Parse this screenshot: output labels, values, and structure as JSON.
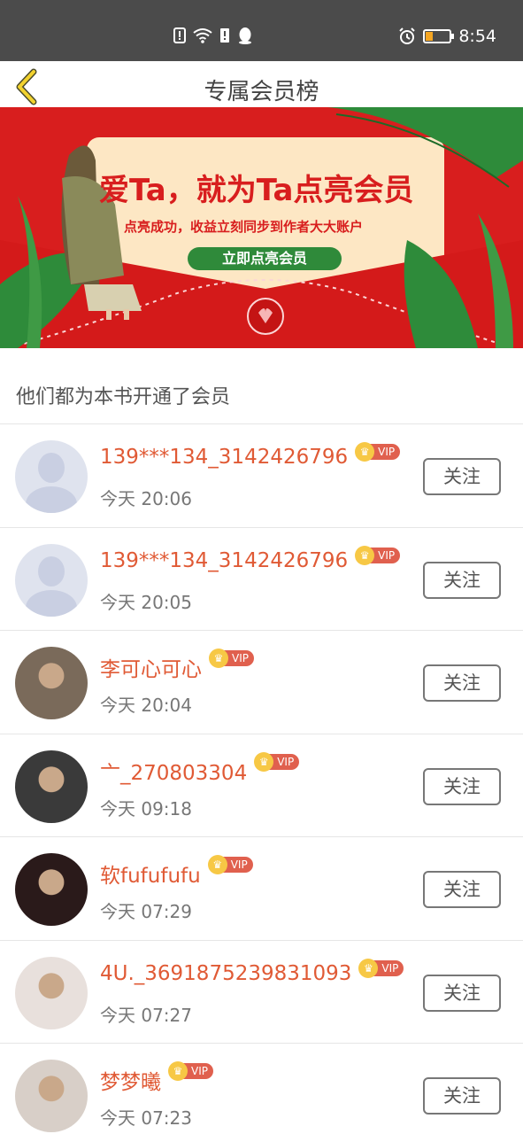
{
  "status_bar": {
    "time": "8:54",
    "icons": [
      "alert-icon",
      "wifi-icon",
      "sim-icon",
      "qq-icon"
    ],
    "right_icons": [
      "alarm-icon",
      "battery-icon"
    ]
  },
  "header": {
    "title": "专属会员榜",
    "back_icon": "chevron-left-icon"
  },
  "banner": {
    "headline": "爱Ta，就为Ta点亮会员",
    "subtitle": "点亮成功，收益立刻同步到作者大大账户",
    "cta": "立即点亮会员"
  },
  "section_label": "他们都为本书开通了会员",
  "vip_label": "VIP",
  "follow_label": "关注",
  "members": [
    {
      "name": "139***134_3142426796",
      "time": "今天 20:06",
      "avatar": "default-avatar"
    },
    {
      "name": "139***134_3142426796",
      "time": "今天 20:05",
      "avatar": "default-avatar"
    },
    {
      "name": "李可心可心",
      "time": "今天 20:04",
      "avatar": "photo-avatar"
    },
    {
      "name": "亠_270803304",
      "time": "今天 09:18",
      "avatar": "photo-avatar"
    },
    {
      "name": "软fufufufu",
      "time": "今天 07:29",
      "avatar": "photo-avatar"
    },
    {
      "name": "4U._3691875239831093",
      "time": "今天 07:27",
      "avatar": "photo-avatar"
    },
    {
      "name": "梦梦曦",
      "time": "今天 07:23",
      "avatar": "photo-avatar"
    }
  ],
  "colors": {
    "status_bar": "#4b4b4b",
    "banner_red": "#d81e1e",
    "name": "#e05a35",
    "vip_tag": "#e0604e",
    "crown": "#f7c845"
  }
}
